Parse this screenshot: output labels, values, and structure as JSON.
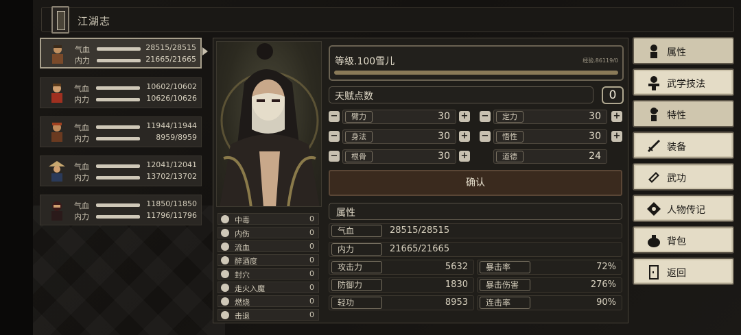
{
  "app": {
    "title": "江湖志"
  },
  "party": [
    {
      "hp_label": "气血",
      "hp": "28515/28515",
      "mp_label": "内力",
      "mp": "21665/21665",
      "selected": true
    },
    {
      "hp_label": "气血",
      "hp": "10602/10602",
      "mp_label": "内力",
      "mp": "10626/10626"
    },
    {
      "hp_label": "气血",
      "hp": "11944/11944",
      "mp_label": "内力",
      "mp": "8959/8959"
    },
    {
      "hp_label": "气血",
      "hp": "12041/12041",
      "mp_label": "内力",
      "mp": "13702/13702"
    },
    {
      "hp_label": "气血",
      "hp": "11850/11850",
      "mp_label": "内力",
      "mp": "11796/11796"
    }
  ],
  "status_effects": [
    {
      "name": "中毒",
      "value": "0",
      "icon": "skull-icon"
    },
    {
      "name": "内伤",
      "value": "0",
      "icon": "broken-heart-icon"
    },
    {
      "name": "流血",
      "value": "0",
      "icon": "blood-drop-icon"
    },
    {
      "name": "醉酒度",
      "value": "0",
      "icon": "wine-icon"
    },
    {
      "name": "封穴",
      "value": "0",
      "icon": "acupoint-icon"
    },
    {
      "name": "走火入魔",
      "value": "0",
      "icon": "demon-icon"
    },
    {
      "name": "燃烧",
      "value": "0",
      "icon": "fire-icon"
    },
    {
      "name": "击退",
      "value": "0",
      "icon": "boot-icon"
    }
  ],
  "level": {
    "text": "等级.100雪儿",
    "exp_label": "经验.86119/0",
    "exp_fill": 1.0
  },
  "talent": {
    "label": "天赋点数",
    "value": "0"
  },
  "attributes": [
    {
      "name": "臂力",
      "value": "30"
    },
    {
      "name": "定力",
      "value": "30"
    },
    {
      "name": "身法",
      "value": "30"
    },
    {
      "name": "悟性",
      "value": "30"
    },
    {
      "name": "根骨",
      "value": "30"
    },
    {
      "name": "道德",
      "value": "24"
    }
  ],
  "confirm_label": "确认",
  "properties": {
    "title": "属性",
    "hp": {
      "label": "气血",
      "value": "28515/28515"
    },
    "mp": {
      "label": "内力",
      "value": "21665/21665"
    },
    "stats": [
      {
        "name": "攻击力",
        "value": "5632"
      },
      {
        "name": "暴击率",
        "value": "72%"
      },
      {
        "name": "防御力",
        "value": "1830"
      },
      {
        "name": "暴击伤害",
        "value": "276%"
      },
      {
        "name": "轻功",
        "value": "8953"
      },
      {
        "name": "连击率",
        "value": "90%"
      }
    ]
  },
  "menu": [
    {
      "label": "属性",
      "icon": "figure-icon"
    },
    {
      "label": "武学技法",
      "icon": "martial-figure-icon"
    },
    {
      "label": "特性",
      "icon": "trait-figure-icon"
    },
    {
      "label": "装备",
      "icon": "sword-icon"
    },
    {
      "label": "武功",
      "icon": "book-icon"
    },
    {
      "label": "人物传记",
      "icon": "bio-icon"
    },
    {
      "label": "背包",
      "icon": "bag-icon"
    },
    {
      "label": "返回",
      "icon": "door-icon"
    }
  ],
  "colors": {
    "panel": "#1f1d19",
    "menu_bg": "#e4dcc6",
    "accent": "#8a7a58",
    "confirm_bg": "#3a2a1e"
  }
}
